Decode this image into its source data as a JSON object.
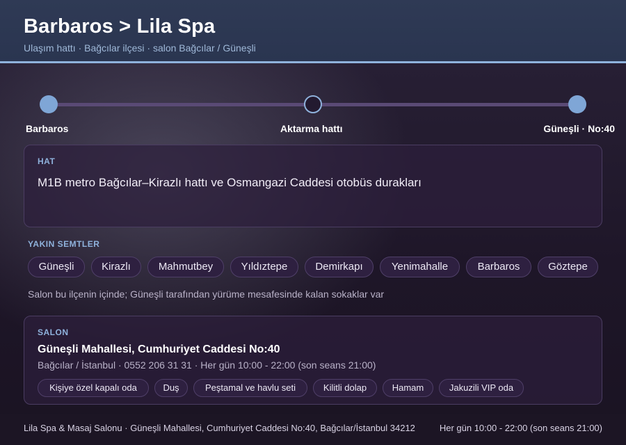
{
  "header": {
    "title": "Barbaros > Lila Spa",
    "subtitle": "Ulaşım hattı · Bağcılar ilçesi · salon Bağcılar / Güneşli"
  },
  "route": {
    "start": "Barbaros",
    "middle": "Aktarma hattı",
    "end": "Güneşli · No:40"
  },
  "hat": {
    "caption": "HAT",
    "text": "M1B metro Bağcılar–Kirazlı hattı ve Osmangazi Caddesi otobüs durakları"
  },
  "nearby": {
    "caption": "YAKIN SEMTLER",
    "items": [
      "Güneşli",
      "Kirazlı",
      "Mahmutbey",
      "Yıldıztepe",
      "Demirkapı",
      "Yenimahalle",
      "Barbaros",
      "Göztepe"
    ],
    "note": "Salon bu ilçenin içinde; Güneşli tarafından yürüme mesafesinde kalan sokaklar var"
  },
  "salon": {
    "caption": "SALON",
    "address": "Güneşli Mahallesi, Cumhuriyet Caddesi No:40",
    "meta": "Bağcılar / İstanbul · 0552 206 31 31 · Her gün 10:00 - 22:00 (son seans 21:00)",
    "features": [
      "Kişiye özel kapalı oda",
      "Duş",
      "Peştamal ve havlu seti",
      "Kilitli dolap",
      "Hamam",
      "Jakuzili VIP oda"
    ]
  },
  "footer": {
    "left": "Lila Spa & Masaj Salonu · Güneşli Mahallesi, Cumhuriyet Caddesi No:40, Bağcılar/İstanbul 34212",
    "right": "Her gün 10:00 - 22:00 (son seans 21:00)"
  }
}
